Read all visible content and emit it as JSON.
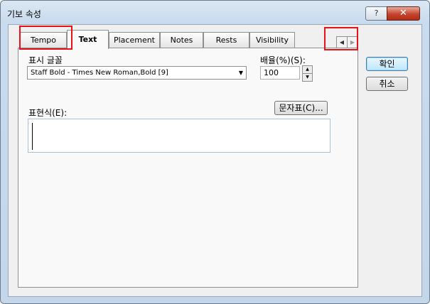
{
  "window": {
    "title": "기보 속성",
    "help_label": "?",
    "close_label": "✕"
  },
  "tabs": [
    {
      "label": "Tempo",
      "active": false
    },
    {
      "label": "Text",
      "active": true
    },
    {
      "label": "Placement",
      "active": false
    },
    {
      "label": "Notes",
      "active": false
    },
    {
      "label": "Rests",
      "active": false
    },
    {
      "label": "Visibility",
      "active": false
    }
  ],
  "tab_scroll": {
    "left_icon": "triangle-left-icon",
    "right_icon": "triangle-right-icon",
    "left_glyph": "◀",
    "right_glyph": "▶"
  },
  "font_section": {
    "label": "표시 글꼴",
    "selected": "Staff Bold - Times New Roman,Bold [9]",
    "arrow_glyph": "▼"
  },
  "scale_section": {
    "label": "배율(%)(S):",
    "value": "100",
    "up_glyph": "▲",
    "down_glyph": "▼"
  },
  "charmap_button": "문자표(C)...",
  "expression_label": "표현식(E):",
  "expression_value": "",
  "buttons": {
    "ok": "확인",
    "cancel": "취소"
  },
  "highlight_color": "#e8111a"
}
